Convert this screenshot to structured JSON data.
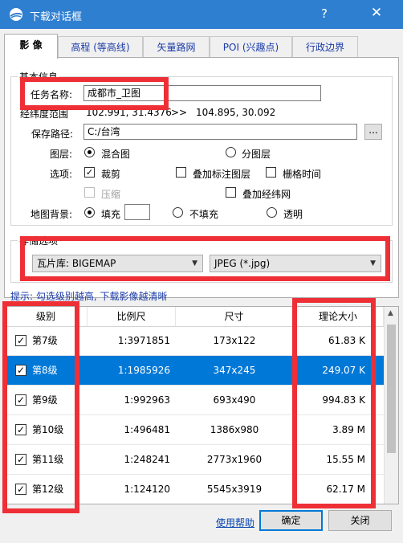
{
  "window": {
    "title": "下载对话框",
    "help": "?",
    "close": "✕"
  },
  "tabs": [
    "影 像",
    "高程 (等高线)",
    "矢量路网",
    "POI (兴趣点)",
    "行政边界"
  ],
  "basic": {
    "group_label": "基本信息",
    "task_name_label": "任务名称:",
    "task_name_value": "成都市_卫图",
    "range_label": "经纬度范围",
    "range_from": "102.991, 31.4376",
    "range_sep": ">>",
    "range_to": "104.895, 30.092",
    "save_path_label": "保存路径:",
    "save_path_value": "C:/台湾",
    "browse_label": "...",
    "layer_label": "图层:",
    "layer_options": [
      "混合图",
      "分图层"
    ],
    "options_label": "选项:",
    "opt_crop": "裁剪",
    "opt_overlay_label": "叠加标注图层",
    "opt_grid_time": "栅格时间",
    "opt_compress": "压缩",
    "opt_overlay_grid": "叠加经纬网",
    "bg_label": "地图背景:",
    "bg_fill": "填充",
    "bg_nofill": "不填充",
    "bg_transparent": "透明"
  },
  "storage": {
    "group_label": "存储选项",
    "tile_lib": "瓦片库: BIGEMAP",
    "format": "JPEG (*.jpg)"
  },
  "hint": "提示: 勾选级别越高, 下载影像越清晰",
  "table": {
    "headers": [
      "级别",
      "比例尺",
      "尺寸",
      "理论大小"
    ],
    "rows": [
      {
        "level": "第7级",
        "scale": "1:3971851",
        "size": "173x122",
        "est": "61.83 K"
      },
      {
        "level": "第8级",
        "scale": "1:1985926",
        "size": "347x245",
        "est": "249.07 K"
      },
      {
        "level": "第9级",
        "scale": "1:992963",
        "size": "693x490",
        "est": "994.83 K"
      },
      {
        "level": "第10级",
        "scale": "1:496481",
        "size": "1386x980",
        "est": "3.89 M"
      },
      {
        "level": "第11级",
        "scale": "1:248241",
        "size": "2773x1960",
        "est": "15.55 M"
      },
      {
        "level": "第12级",
        "scale": "1:124120",
        "size": "5545x3919",
        "est": "62.17 M"
      }
    ]
  },
  "footer": {
    "help_link": "使用帮助",
    "ok": "确定",
    "close": "关闭"
  },
  "checkmark": "✓",
  "colors": {
    "titlebar": "#2f7fd1",
    "selection": "#0078d7",
    "annotation": "#ee2f36",
    "link": "#1a3aa8"
  }
}
